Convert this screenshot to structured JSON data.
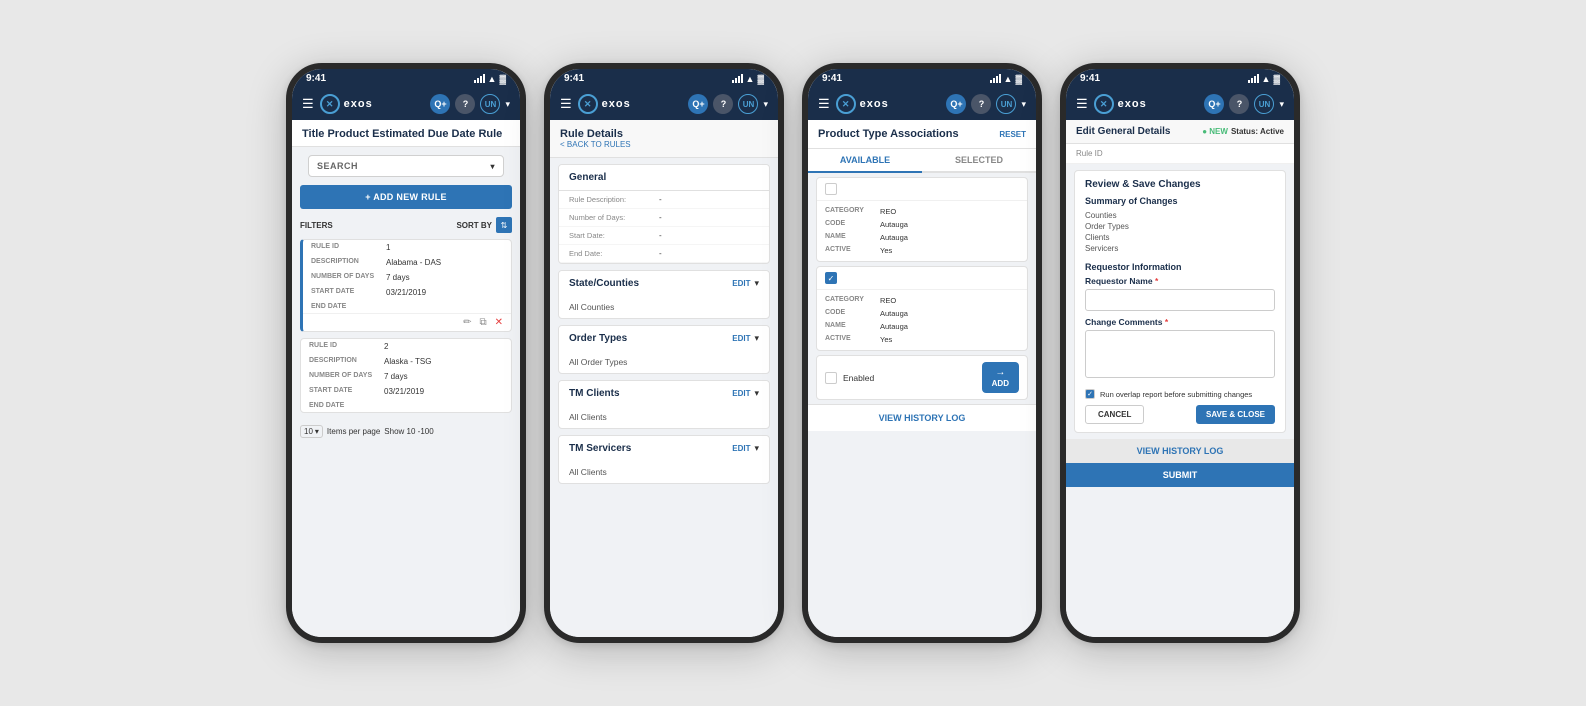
{
  "phone1": {
    "statusBar": {
      "time": "9:41",
      "battery": "▓▓▓"
    },
    "navBar": {
      "logoText": "exos",
      "icons": [
        "Q+",
        "?",
        "UN"
      ]
    },
    "pageTitle": "Title Product Estimated Due Date Rule",
    "searchPlaceholder": "SEARCH",
    "addRuleBtn": "+ ADD NEW RULE",
    "filtersLabel": "FILTERS",
    "sortByLabel": "SORT BY",
    "rules": [
      {
        "ruleId": "1",
        "description": "Alabama - DAS",
        "numberOfDays": "7 days",
        "startDate": "03/21/2019",
        "endDate": ""
      },
      {
        "ruleId": "2",
        "description": "Alaska - TSG",
        "numberOfDays": "7 days",
        "startDate": "03/21/2019",
        "endDate": ""
      }
    ],
    "labels": {
      "ruleId": "RULE ID",
      "description": "DESCRIPTION",
      "numberOfDays": "NUMBER OF DAYS",
      "startDate": "START DATE",
      "endDate": "END DATE"
    },
    "pagination": {
      "perPage": "10",
      "show": "Show 10 -100",
      "itemsPerPage": "Items per page"
    }
  },
  "phone2": {
    "statusBar": {
      "time": "9:41"
    },
    "pageTitle": "Rule Details",
    "backLink": "< BACK TO RULES",
    "sections": {
      "general": {
        "title": "General",
        "fields": [
          {
            "label": "Rule Description:",
            "value": "-"
          },
          {
            "label": "Number of Days:",
            "value": "-"
          },
          {
            "label": "Start Date:",
            "value": "-"
          },
          {
            "label": "End Date:",
            "value": "-"
          }
        ]
      },
      "stateCounties": {
        "title": "State/Counties",
        "editLabel": "EDIT",
        "body": "All Counties"
      },
      "orderTypes": {
        "title": "Order Types",
        "editLabel": "EDIT",
        "body": "All Order Types"
      },
      "tmClients": {
        "title": "TM Clients",
        "editLabel": "EDIT",
        "body": "All Clients"
      },
      "tmServicers": {
        "title": "TM Servicers",
        "editLabel": "EDIT",
        "body": "All Clients"
      }
    }
  },
  "phone3": {
    "statusBar": {
      "time": "9:41"
    },
    "pageTitle": "Product Type Associations",
    "resetBtn": "RESET",
    "tabs": [
      "AVAILABLE",
      "SELECTED"
    ],
    "products": [
      {
        "checked": false,
        "category": "REO",
        "code": "Autauga",
        "name": "Autauga",
        "active": "Yes"
      },
      {
        "checked": true,
        "category": "REO",
        "code": "Autauga",
        "name": "Autauga",
        "active": "Yes"
      }
    ],
    "labels": {
      "category": "CATEGORY",
      "code": "CODE",
      "name": "NAME",
      "active": "ACTIVE"
    },
    "enabledLabel": "Enabled",
    "addBtn": "ADD",
    "viewHistoryLog": "VIEW HISTORY LOG"
  },
  "phone4": {
    "statusBar": {
      "time": "9:41"
    },
    "headerTitle": "Edit General Details",
    "statusNew": "● NEW",
    "statusActive": "Status: Active",
    "ruleIdLabel": "Rule ID",
    "reviewSection": {
      "title": "Review & Save Changes",
      "summaryTitle": "Summary of Changes",
      "summaryItems": [
        "Counties",
        "Order Types",
        "Clients",
        "Servicers"
      ]
    },
    "requestorSection": {
      "title": "Requestor Information",
      "nameLabel": "Requestor Name",
      "required": "*",
      "commentsLabel": "Change Comments",
      "commentsRequired": "*"
    },
    "overlapLabel": "Run overlap report before submitting changes",
    "cancelBtn": "CANCEL",
    "saveBtn": "SAVE & CLOSE",
    "viewHistoryLog": "VIEW HISTORY LOG",
    "submitBtn": "SUBMIT"
  }
}
